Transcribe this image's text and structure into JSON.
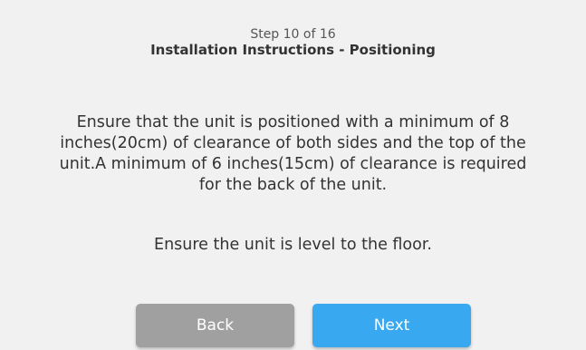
{
  "header": {
    "step": "Step 10 of 16",
    "title": "Installation Instructions - Positioning"
  },
  "content": {
    "instructions": "Ensure that the unit is positioned with a minimum of 8 inches(20cm) of clearance of both sides and the top of the unit.A minimum of 6 inches(15cm) of clearance is required for the back of the unit.",
    "note": "Ensure the unit is level to the floor."
  },
  "buttons": {
    "back": "Back",
    "next": "Next"
  },
  "colors": {
    "background": "#f1f1f1",
    "back_button": "#a0a0a0",
    "next_button": "#38a8f0"
  }
}
